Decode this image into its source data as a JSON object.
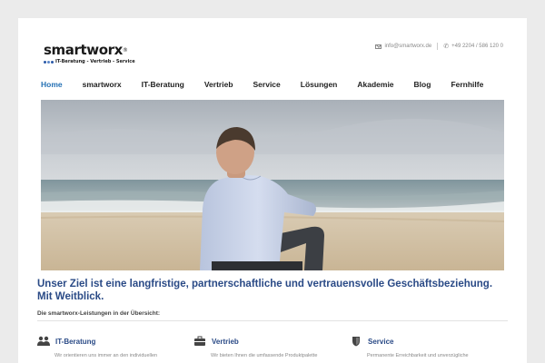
{
  "header": {
    "logo_text": "smartworx",
    "logo_reg": "®",
    "logo_tagline": "IT-Beratung - Vertrieb - Service",
    "email": "info@smartworx.de",
    "phone": "+49 2204 / 586 120 0"
  },
  "nav": {
    "items": [
      {
        "label": "Home",
        "active": true
      },
      {
        "label": "smartworx"
      },
      {
        "label": "IT-Beratung"
      },
      {
        "label": "Vertrieb"
      },
      {
        "label": "Service"
      },
      {
        "label": "Lösungen"
      },
      {
        "label": "Akademie"
      },
      {
        "label": "Blog"
      },
      {
        "label": "Fernhilfe"
      }
    ]
  },
  "main": {
    "headline_line1": "Unser Ziel ist eine langfristige, partnerschaftliche und vertrauensvolle Geschäftsbeziehung.",
    "headline_line2": "Mit Weitblick.",
    "intro": "Die smartworx-Leistungen in der Übersicht:",
    "services": [
      {
        "title": "IT-Beratung",
        "text": "Wir orientieren uns immer an den individuellen",
        "icon": "users-icon"
      },
      {
        "title": "Vertrieb",
        "text": "Wir bieten Ihnen die umfassende Produktpalette",
        "icon": "briefcase-icon"
      },
      {
        "title": "Service",
        "text": "Permanente Erreichbarkeit und unverzügliche",
        "icon": "shield-icon"
      }
    ]
  },
  "colors": {
    "accent": "#2470b4",
    "headline": "#2a4a86",
    "background": "#ebebeb"
  }
}
